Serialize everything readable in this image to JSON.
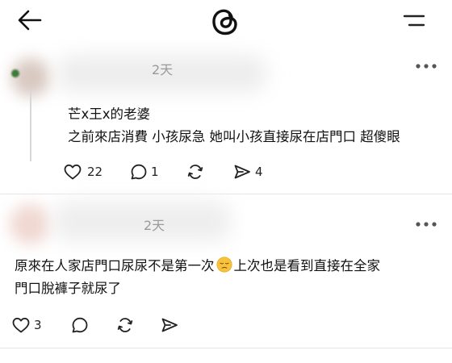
{
  "header": {
    "back_icon": "arrow-left-icon",
    "logo_icon": "threads-logo-icon",
    "menu_icon": "menu-lines-icon"
  },
  "posts": [
    {
      "timestamp": "2天",
      "lines": [
        "芒x王x的老婆",
        "之前來店消費 小孩尿急 她叫小孩直接尿在店門口 超傻眼"
      ],
      "actions": {
        "likes": "22",
        "replies": "1",
        "reposts": "",
        "shares": "4"
      }
    },
    {
      "timestamp": "2天",
      "line1_before_emoji": "原來在人家店門口尿尿不是第一次",
      "emoji": "pensive-face-emoji",
      "line1_after_emoji": "上次也是看到直接在全家",
      "line2": "門口脫褲子就尿了",
      "actions": {
        "likes": "3",
        "replies": "",
        "reposts": "",
        "shares": ""
      }
    }
  ]
}
